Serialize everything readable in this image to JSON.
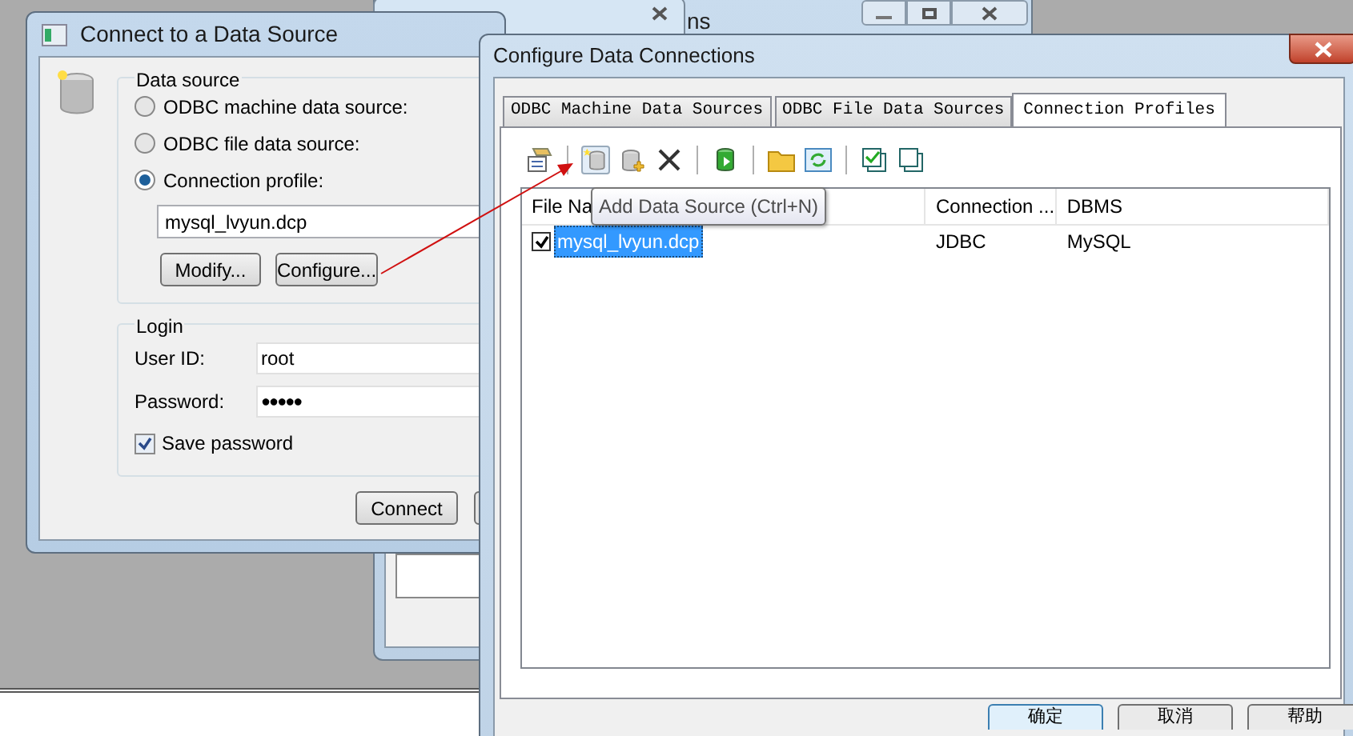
{
  "background_window": {
    "title_fragment": "ns"
  },
  "connect_dialog": {
    "title": "Connect to a Data Source",
    "data_source": {
      "label": "Data source",
      "options": [
        {
          "label": "ODBC machine data source:",
          "selected": false
        },
        {
          "label": "ODBC file data source:",
          "selected": false
        },
        {
          "label": "Connection profile:",
          "selected": true
        }
      ],
      "profile": "mysql_lvyun.dcp",
      "buttons": [
        "Modify...",
        "Configure..."
      ]
    },
    "login": {
      "label": "Login",
      "user_id_label": "User ID:",
      "user_id": "root",
      "password_label": "Password:",
      "password": "●●●●●",
      "save_password": {
        "label": "Save password",
        "checked": true
      }
    },
    "buttons": [
      "Connect"
    ]
  },
  "configure_dialog": {
    "title": "Configure Data Connections",
    "tabs": [
      {
        "label": "ODBC Machine Data Sources",
        "selected": false
      },
      {
        "label": "ODBC File Data Sources",
        "selected": false
      },
      {
        "label": "Connection Profiles",
        "selected": true
      }
    ],
    "tooltip": "Add Data Source (Ctrl+N)",
    "columns": [
      "File Na",
      "Connection ...",
      "DBMS"
    ],
    "rows": [
      {
        "cells": [
          "mysql_lvyun.dcp",
          "JDBC",
          "MySQL"
        ],
        "checked": true,
        "selected": true
      }
    ],
    "buttons": [
      "确定",
      "取消",
      "帮助"
    ]
  }
}
